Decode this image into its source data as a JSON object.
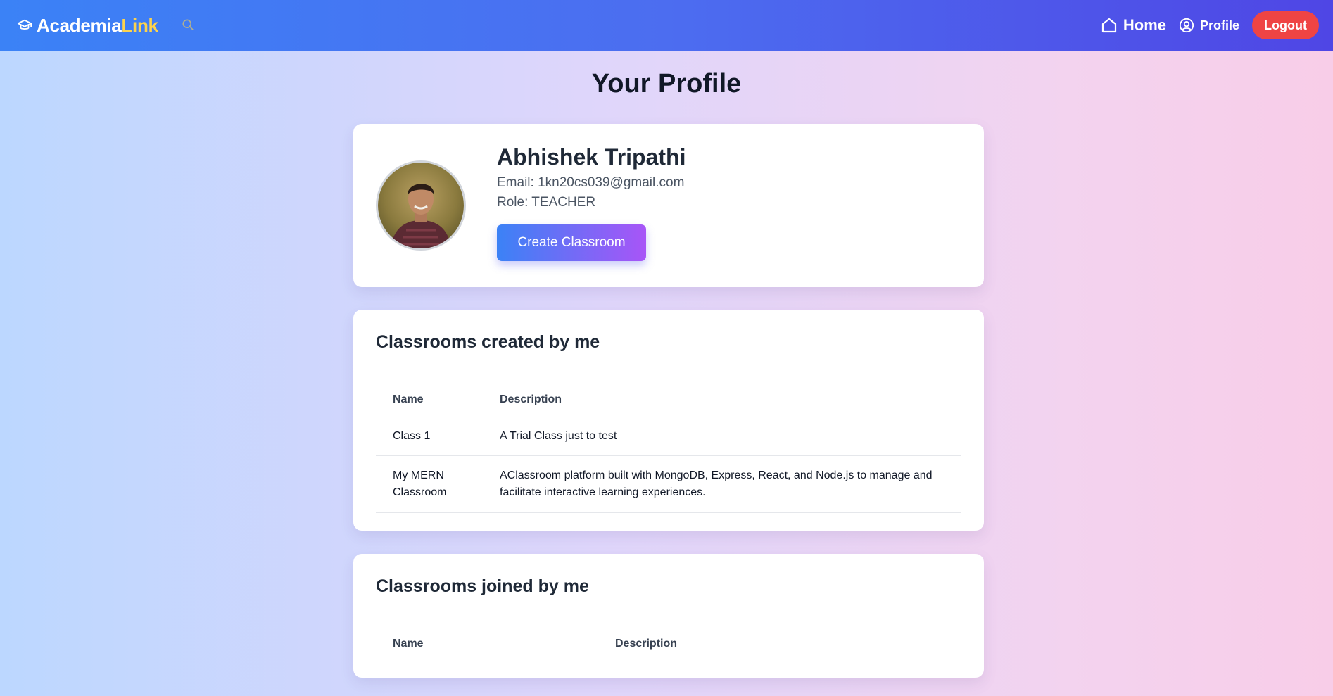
{
  "navbar": {
    "brand_main": "Academia",
    "brand_accent": "Link",
    "home_label": "Home",
    "profile_label": "Profile",
    "logout_label": "Logout",
    "icons": [
      "graduation-cap-icon",
      "search-icon",
      "home-icon",
      "user-circle-icon"
    ]
  },
  "page": {
    "title": "Your Profile"
  },
  "profile": {
    "name": "Abhishek Tripathi",
    "email_line": "Email: 1kn20cs039@gmail.com",
    "role_line": "Role: TEACHER",
    "create_button": "Create Classroom"
  },
  "created": {
    "title": "Classrooms created by me",
    "headers": {
      "name": "Name",
      "description": "Description"
    },
    "rows": [
      {
        "name": "Class 1",
        "description": "A Trial Class just to test"
      },
      {
        "name": "My MERN Classroom",
        "description": "AClassroom platform built with MongoDB, Express, React, and Node.js to manage and facilitate interactive learning experiences."
      }
    ]
  },
  "joined": {
    "title": "Classrooms joined by me",
    "headers": {
      "name": "Name",
      "description": "Description"
    }
  },
  "colors": {
    "nav_start": "#3b82f6",
    "nav_end": "#4f46e5",
    "brand_accent": "#fcd34d",
    "logout": "#ef4444",
    "button_start": "#3b82f6",
    "button_end": "#a855f7"
  }
}
